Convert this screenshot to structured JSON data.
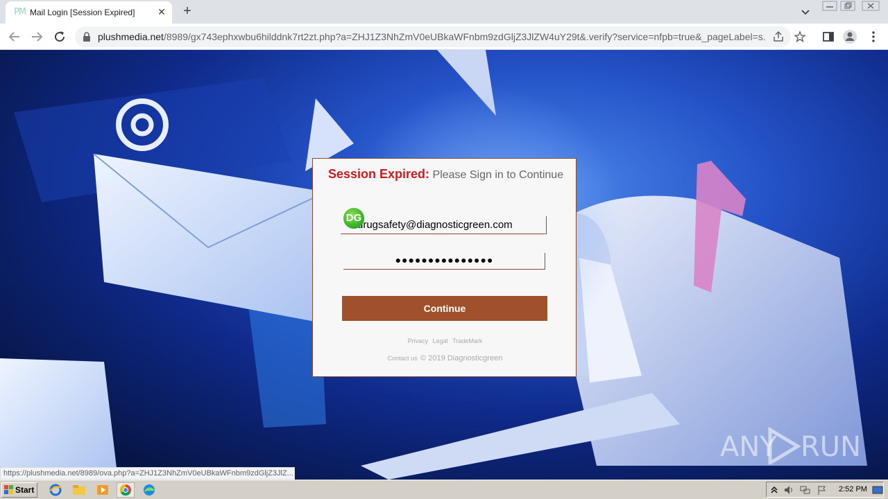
{
  "browser": {
    "tab_title": "Mail Login [Session Expired]",
    "tab_favicon_text": "PM",
    "url_host": "plushmedia.net",
    "url_path": "/8989/gx743ephxwbu6hilddnk7rt2zt.php?a=ZHJ1Z3NhZmV0eUBkaWFnbm9zdGljZ3JlZW4uY29t&.verify?service=nfpb=true&_pageLabel=s...",
    "status_url": "https://plushmedia.net/8989/ova.php?a=ZHJ1Z3NhZmV0eUBkaWFnbm9zdGljZ3JlZ..."
  },
  "login": {
    "heading_strong": "Session Expired:",
    "heading_sub": "Please Sign in to Continue",
    "avatar_initials": "DG",
    "email_value": "drugsafety@diagnosticgreen.com",
    "password_mask": "●●●●●●●●●●●●●●●",
    "continue_label": "Continue",
    "footer_links": [
      "Privacy",
      "Legal",
      "TradeMark"
    ],
    "contact_label": "Contact us",
    "copyright": "© 2019 Diagnosticgreen"
  },
  "watermark": {
    "text": "ANY RUN"
  },
  "taskbar": {
    "start_label": "Start",
    "clock": "2:52 PM"
  },
  "colors": {
    "heading_red": "#d0191d",
    "button_brown": "#a0502a",
    "card_border": "#8a4a2c"
  },
  "icons": [
    "lock-icon",
    "share-icon",
    "star-icon",
    "sidebar-icon",
    "profile-icon",
    "kebab-menu-icon",
    "back-arrow-icon",
    "forward-arrow-icon",
    "reload-icon"
  ]
}
